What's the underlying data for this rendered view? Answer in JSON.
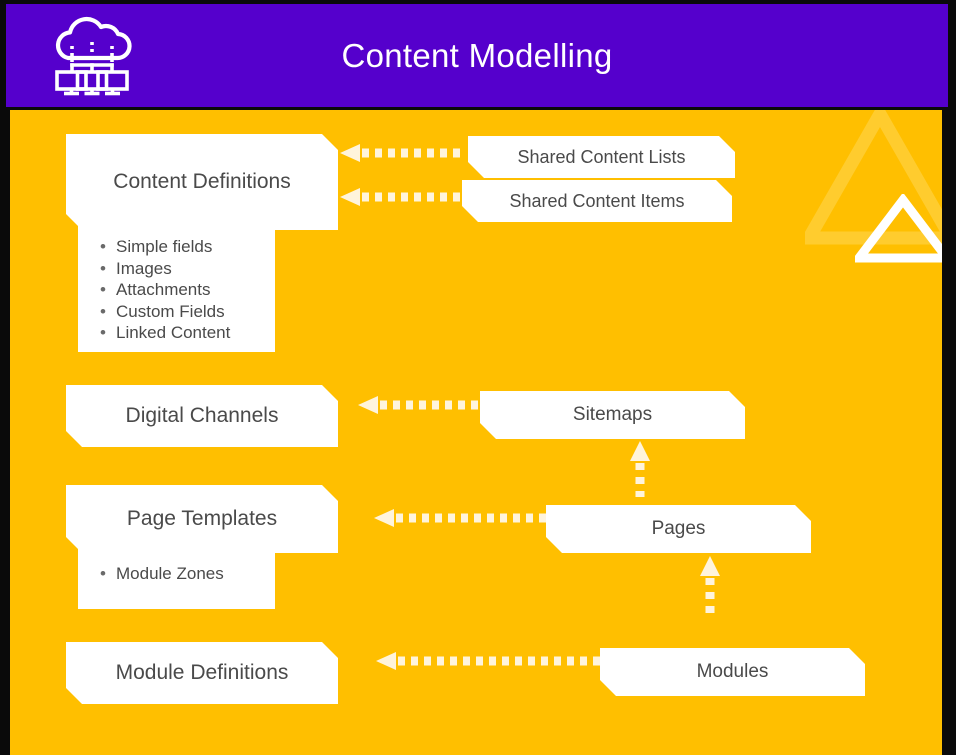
{
  "header": {
    "title": "Content Modelling",
    "icon": "cloud-network-icon",
    "background_color": "#5500CC",
    "text_color": "#FFFFFF"
  },
  "theme": {
    "body_background": "#FFBF00",
    "card_background": "#FFFFFF",
    "card_text_color": "#4A4A4A",
    "arrow_color": "#FFF4DC",
    "frame_color": "#000000"
  },
  "decorations": {
    "triangle_large": "triangle-outline-icon",
    "triangle_small": "triangle-outline-icon"
  },
  "diagram": {
    "cards": {
      "content_definitions": {
        "label": "Content Definitions",
        "bullets": [
          "Simple fields",
          "Images",
          "Attachments",
          "Custom Fields",
          "Linked Content"
        ]
      },
      "shared_content_lists": {
        "label": "Shared Content Lists"
      },
      "shared_content_items": {
        "label": "Shared Content Items"
      },
      "digital_channels": {
        "label": "Digital Channels"
      },
      "sitemaps": {
        "label": "Sitemaps"
      },
      "page_templates": {
        "label": "Page Templates",
        "bullets": [
          "Module Zones"
        ]
      },
      "pages": {
        "label": "Pages"
      },
      "module_definitions": {
        "label": "Module Definitions"
      },
      "modules": {
        "label": "Modules"
      }
    },
    "connectors": [
      {
        "name": "shared-content-lists-to-content-definitions",
        "direction": "left",
        "style": "dashed"
      },
      {
        "name": "shared-content-items-to-content-definitions",
        "direction": "left",
        "style": "dashed"
      },
      {
        "name": "sitemaps-to-digital-channels",
        "direction": "left",
        "style": "dashed"
      },
      {
        "name": "pages-to-page-templates",
        "direction": "left",
        "style": "dashed"
      },
      {
        "name": "modules-to-module-definitions",
        "direction": "left",
        "style": "dashed"
      },
      {
        "name": "pages-to-sitemaps",
        "direction": "up",
        "style": "dashed"
      },
      {
        "name": "modules-to-pages",
        "direction": "up",
        "style": "dashed"
      }
    ]
  }
}
